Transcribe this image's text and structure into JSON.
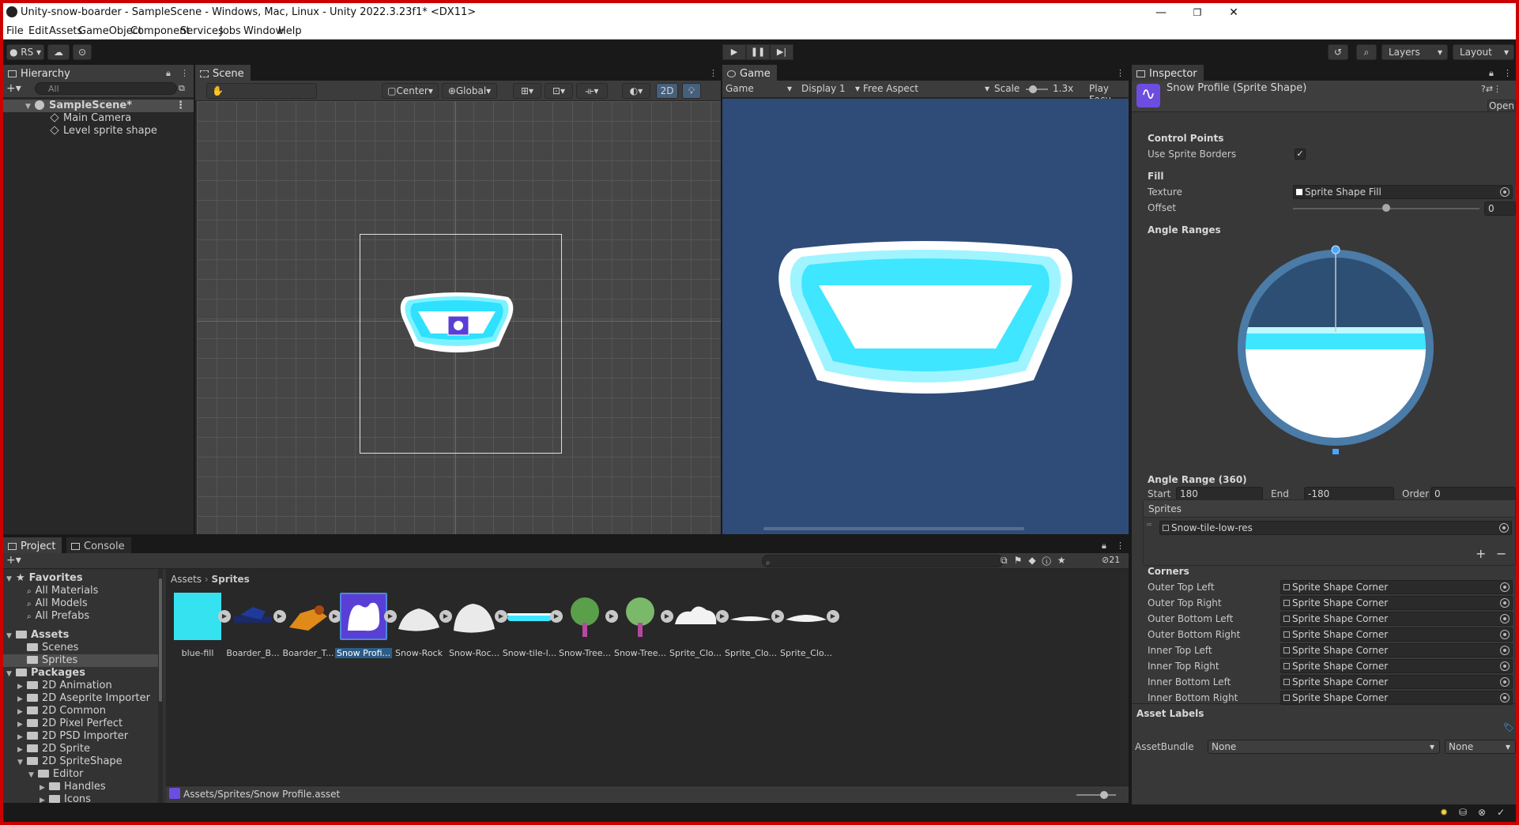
{
  "window": {
    "title": "Unity-snow-boarder - SampleScene - Windows, Mac, Linux - Unity 2022.3.23f1* <DX11>",
    "controls": [
      "—",
      "❐",
      "✕"
    ]
  },
  "menu": [
    "File",
    "Edit",
    "Assets",
    "GameObject",
    "Component",
    "Services",
    "Jobs",
    "Window",
    "Help"
  ],
  "toolbar": {
    "account": "RS",
    "layers_label": "Layers",
    "layout_label": "Layout"
  },
  "hierarchy": {
    "tab": "Hierarchy",
    "search_placeholder": "All",
    "items": [
      {
        "label": "SampleScene*"
      },
      {
        "label": "Main Camera"
      },
      {
        "label": "Level sprite shape"
      }
    ]
  },
  "scene": {
    "tab": "Scene",
    "pivot": "Center",
    "space": "Global",
    "mode_2d": "2D"
  },
  "game": {
    "tab": "Game",
    "mode": "Game",
    "display": "Display 1",
    "aspect": "Free Aspect",
    "scale_label": "Scale",
    "scale_value": "1.3x",
    "play_focus": "Play Focu"
  },
  "inspector": {
    "tab": "Inspector",
    "asset_title": "Snow Profile (Sprite Shape)",
    "open_button": "Open",
    "control_points_header": "Control Points",
    "use_sprite_borders_label": "Use Sprite Borders",
    "use_sprite_borders_value": true,
    "fill_header": "Fill",
    "texture_label": "Texture",
    "texture_value": "Sprite Shape Fill",
    "offset_label": "Offset",
    "offset_value": "0",
    "offset_slider_fraction": 0.5,
    "angle_ranges_header": "Angle Ranges",
    "angle_range_title": "Angle Range (360)",
    "start_label": "Start",
    "start_value": "180",
    "end_label": "End",
    "end_value": "-180",
    "order_label": "Order",
    "order_value": "0",
    "sprites_header": "Sprites",
    "sprite_item": "Snow-tile-low-res",
    "add_btn": "+",
    "remove_btn": "−",
    "corners_header": "Corners",
    "corners": [
      {
        "label": "Outer Top Left",
        "value": "Sprite Shape Corner"
      },
      {
        "label": "Outer Top Right",
        "value": "Sprite Shape Corner"
      },
      {
        "label": "Outer Bottom Left",
        "value": "Sprite Shape Corner"
      },
      {
        "label": "Outer Bottom Right",
        "value": "Sprite Shape Corner"
      },
      {
        "label": "Inner Top Left",
        "value": "Sprite Shape Corner"
      },
      {
        "label": "Inner Top Right",
        "value": "Sprite Shape Corner"
      },
      {
        "label": "Inner Bottom Left",
        "value": "Sprite Shape Corner"
      },
      {
        "label": "Inner Bottom Right",
        "value": "Sprite Shape Corner"
      }
    ],
    "asset_labels_header": "Asset Labels",
    "asset_bundle_label": "AssetBundle",
    "asset_bundle_value": "None",
    "asset_bundle_variant": "None"
  },
  "project": {
    "tab": "Project",
    "console_tab": "Console",
    "hidden_count": "21",
    "breadcrumb_root": "Assets",
    "breadcrumb_current": "Sprites",
    "footer_path": "Assets/Sprites/Snow Profile.asset",
    "tree": [
      {
        "label": "Favorites",
        "bold": true
      },
      {
        "label": "All Materials"
      },
      {
        "label": "All Models"
      },
      {
        "label": "All Prefabs"
      },
      {
        "label": "Assets",
        "bold": true
      },
      {
        "label": "Scenes"
      },
      {
        "label": "Sprites"
      },
      {
        "label": "Packages",
        "bold": true
      },
      {
        "label": "2D Animation"
      },
      {
        "label": "2D Aseprite Importer"
      },
      {
        "label": "2D Common"
      },
      {
        "label": "2D Pixel Perfect"
      },
      {
        "label": "2D PSD Importer"
      },
      {
        "label": "2D Sprite"
      },
      {
        "label": "2D SpriteShape"
      },
      {
        "label": "Editor"
      },
      {
        "label": "Handles"
      },
      {
        "label": "Icons"
      }
    ],
    "assets": [
      {
        "label": "blue-fill"
      },
      {
        "label": "Boarder_B..."
      },
      {
        "label": "Boarder_T..."
      },
      {
        "label": "Snow Profi..."
      },
      {
        "label": "Snow-Rock"
      },
      {
        "label": "Snow-Roc..."
      },
      {
        "label": "Snow-tile-l..."
      },
      {
        "label": "Snow-Tree..."
      },
      {
        "label": "Snow-Tree..."
      },
      {
        "label": "Sprite_Clo..."
      },
      {
        "label": "Sprite_Clo..."
      },
      {
        "label": "Sprite_Clo..."
      }
    ]
  },
  "colors": {
    "game_bg": "#2f4c78",
    "snow_cyan": "#3ee6ff",
    "accent_select": "#2c5d87",
    "blue_fill": "#35e2f0"
  }
}
